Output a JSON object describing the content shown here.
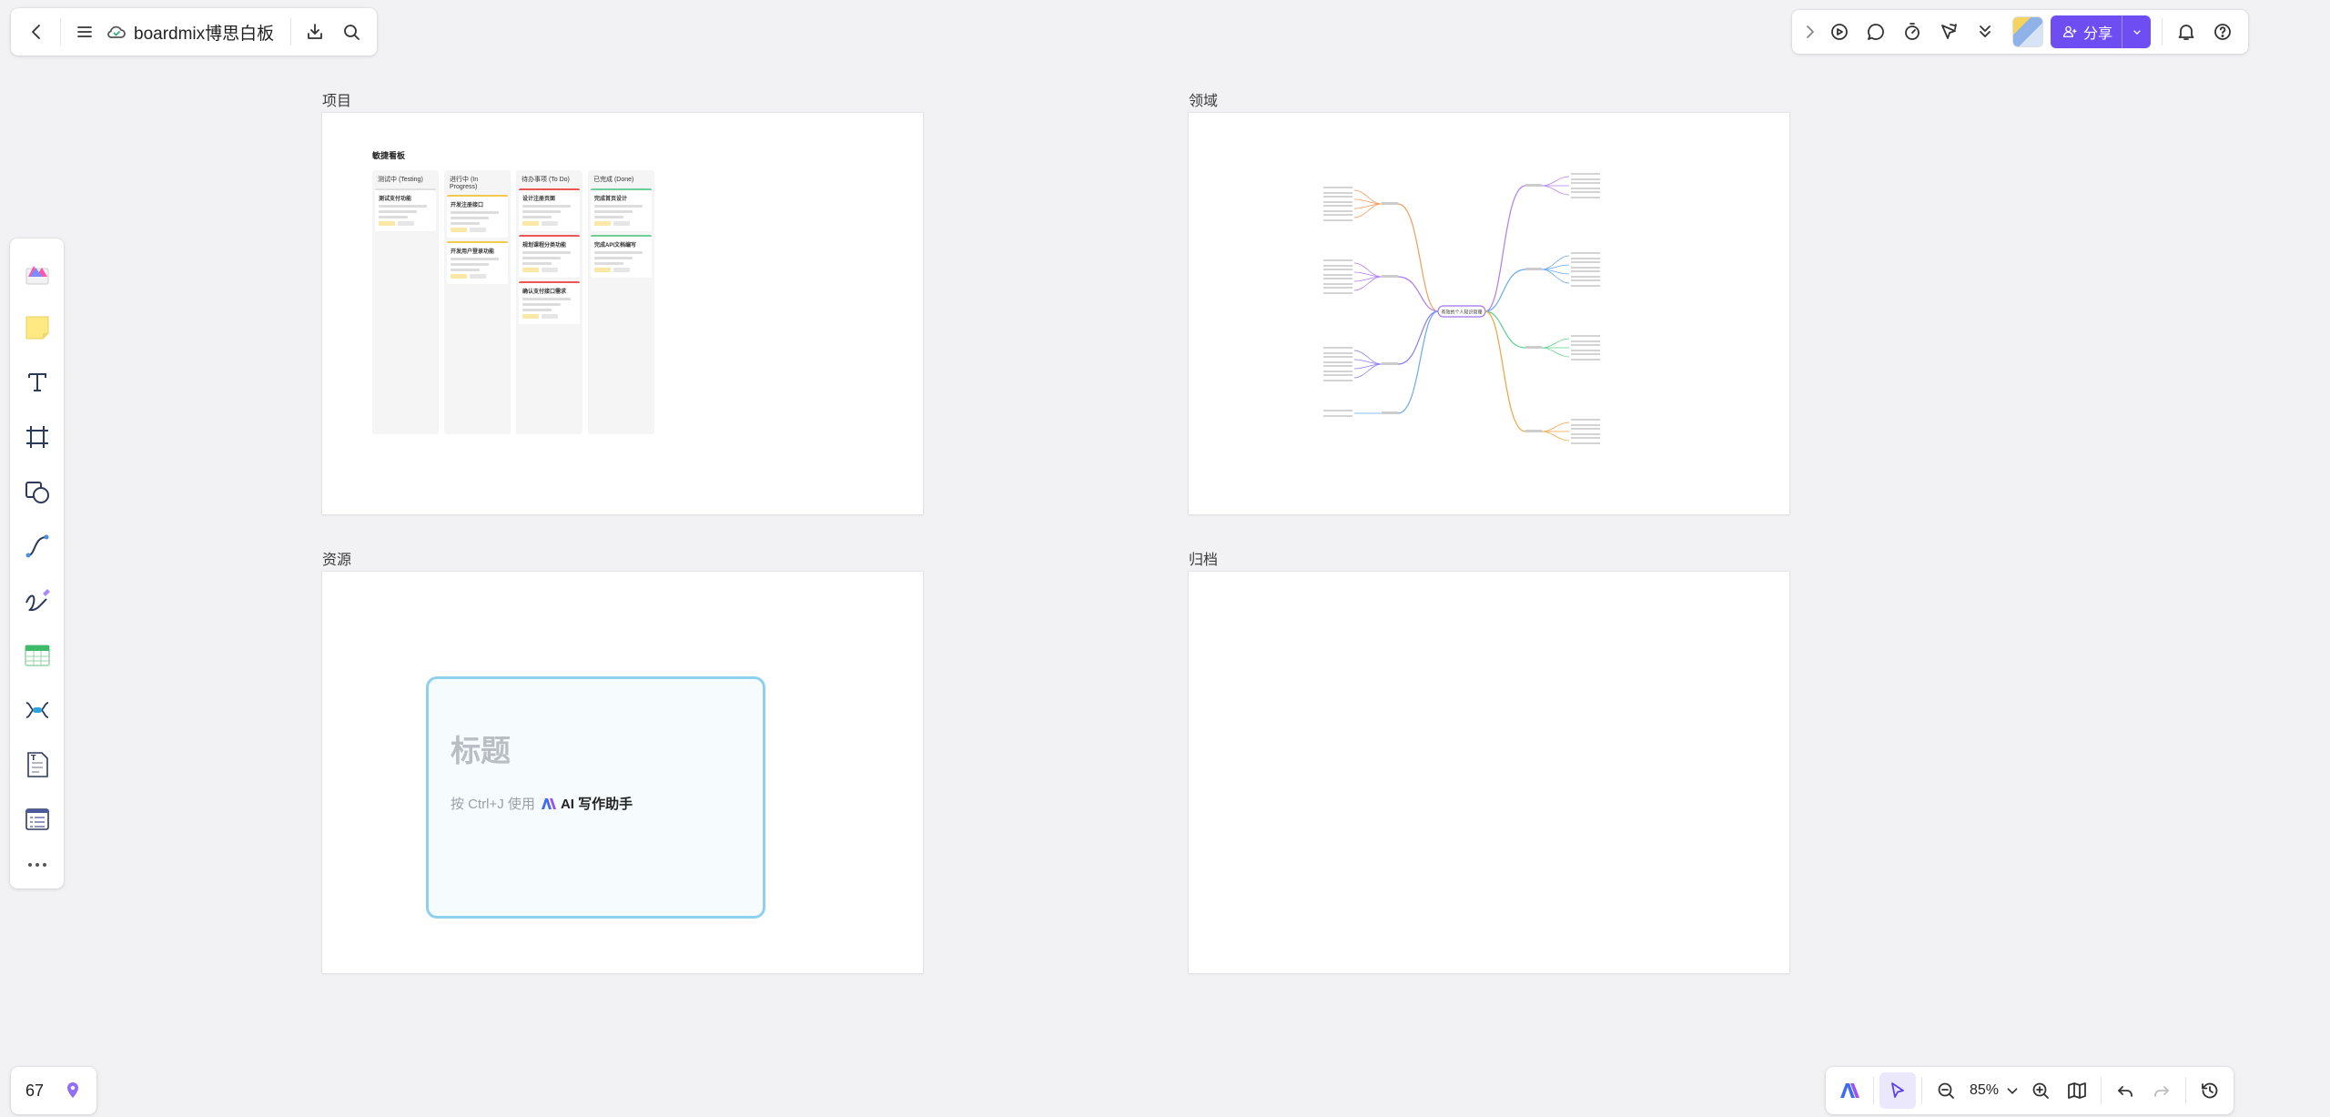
{
  "top_bar": {
    "board_title": "boardmix博思白板"
  },
  "top_right": {
    "share_label": "分享"
  },
  "frames": [
    {
      "label": "项目"
    },
    {
      "label": "领域"
    },
    {
      "label": "资源"
    },
    {
      "label": "归档"
    }
  ],
  "kanban": {
    "title": "敏捷看板",
    "columns": [
      {
        "name": "测试中 (Testing)",
        "cards": [
          "测试支付功能"
        ]
      },
      {
        "name": "进行中 (In Progress)",
        "cards": [
          "开发注册接口",
          "开发用户登录功能"
        ]
      },
      {
        "name": "待办事项 (To Do)",
        "cards": [
          "设计注册页面",
          "规划课程分类功能",
          "确认支付接口需求"
        ]
      },
      {
        "name": "已完成 (Done)",
        "cards": [
          "完成首页设计",
          "完成API文档编写"
        ]
      }
    ]
  },
  "mindmap": {
    "root": "有效的个人知识管理"
  },
  "doc_card": {
    "title": "标题",
    "hint": "按 Ctrl+J 使用",
    "ai_label": "AI 写作助手"
  },
  "bottom_left": {
    "page_count": "67"
  },
  "bottom_right": {
    "zoom": "85%"
  },
  "colors": {
    "accent": "#6e4ef2",
    "doc_card_border": "#8fd0ee"
  }
}
